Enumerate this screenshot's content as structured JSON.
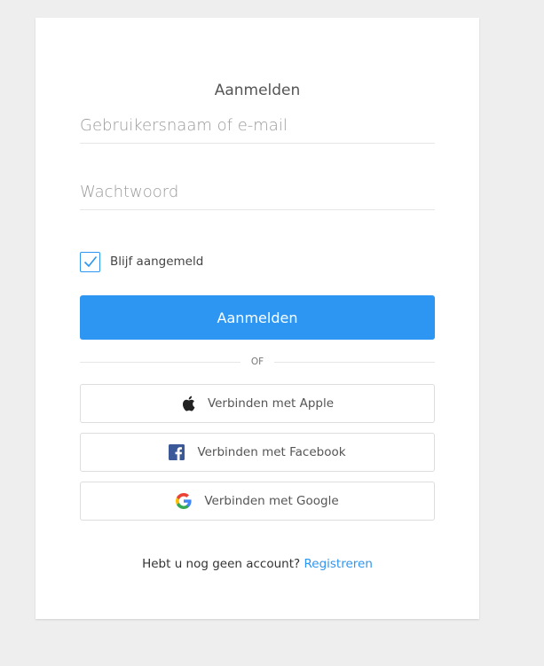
{
  "form": {
    "title": "Aanmelden",
    "username_placeholder": "Gebruikersnaam of e-mail",
    "password_placeholder": "Wachtwoord",
    "remember_label": "Blijf aangemeld",
    "remember_checked": true,
    "submit_label": "Aanmelden",
    "divider_text": "OF"
  },
  "social": {
    "apple": {
      "label": "Verbinden met Apple",
      "icon": "apple-icon"
    },
    "facebook": {
      "label": "Verbinden met Facebook",
      "icon": "facebook-icon"
    },
    "google": {
      "label": "Verbinden met Google",
      "icon": "google-icon"
    }
  },
  "footer": {
    "prompt": "Hebt u nog geen account?",
    "register_link": "Registreren"
  },
  "colors": {
    "accent": "#2d96f3",
    "background": "#eeeeee",
    "card": "#ffffff"
  }
}
